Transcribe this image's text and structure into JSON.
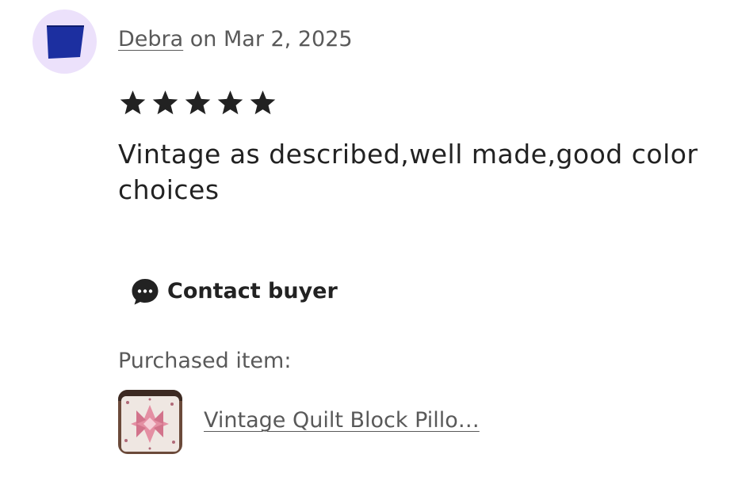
{
  "review": {
    "reviewer_name": "Debra",
    "date_text": " on Mar 2, 2025",
    "rating": 5,
    "rating_max": 5,
    "text": "Vintage as described,well made,good color choices"
  },
  "actions": {
    "contact_label": "Contact buyer",
    "contact_icon": "speech-bubble-dots-icon"
  },
  "purchase": {
    "label": "Purchased item:",
    "item_title": "Vintage Quilt Block Pillo…"
  },
  "colors": {
    "avatar_bg": "#ece1fb",
    "avatar_shape": "#1c2fa0",
    "text_primary": "#222222",
    "text_secondary": "#595959"
  }
}
